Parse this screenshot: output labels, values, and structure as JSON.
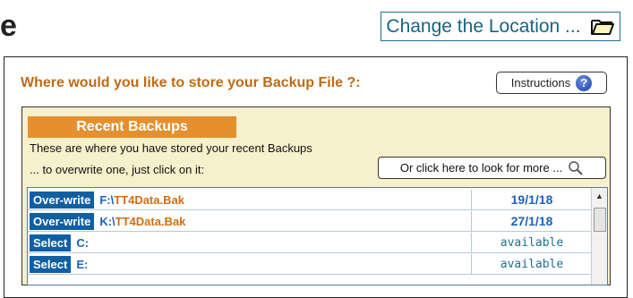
{
  "header": {
    "title_fragment": "e",
    "change_location_label": "Change the Location ..."
  },
  "panel": {
    "question": "Where would you like to store your Backup File ?:",
    "instructions_label": "Instructions",
    "recent": {
      "title": "Recent Backups",
      "description_line1": "These are where you have stored your recent Backups",
      "description_line2": "... to overwrite one, just click on it:",
      "look_more_label": "Or click here to look for more ..."
    },
    "rows": [
      {
        "action": "Over-write",
        "drive": "F:\\",
        "file": "TT4Data.Bak",
        "status": "19/1/18"
      },
      {
        "action": "Over-write",
        "drive": "K:\\",
        "file": "TT4Data.Bak",
        "status": "27/1/18"
      },
      {
        "action": "Select",
        "drive": "C:",
        "file": "",
        "status": "available"
      },
      {
        "action": "Select",
        "drive": "E:",
        "file": "",
        "status": "available"
      }
    ]
  },
  "icons": {
    "folder": "folder-open-icon",
    "help": "help-question-icon",
    "magnifier": "magnifier-icon"
  }
}
